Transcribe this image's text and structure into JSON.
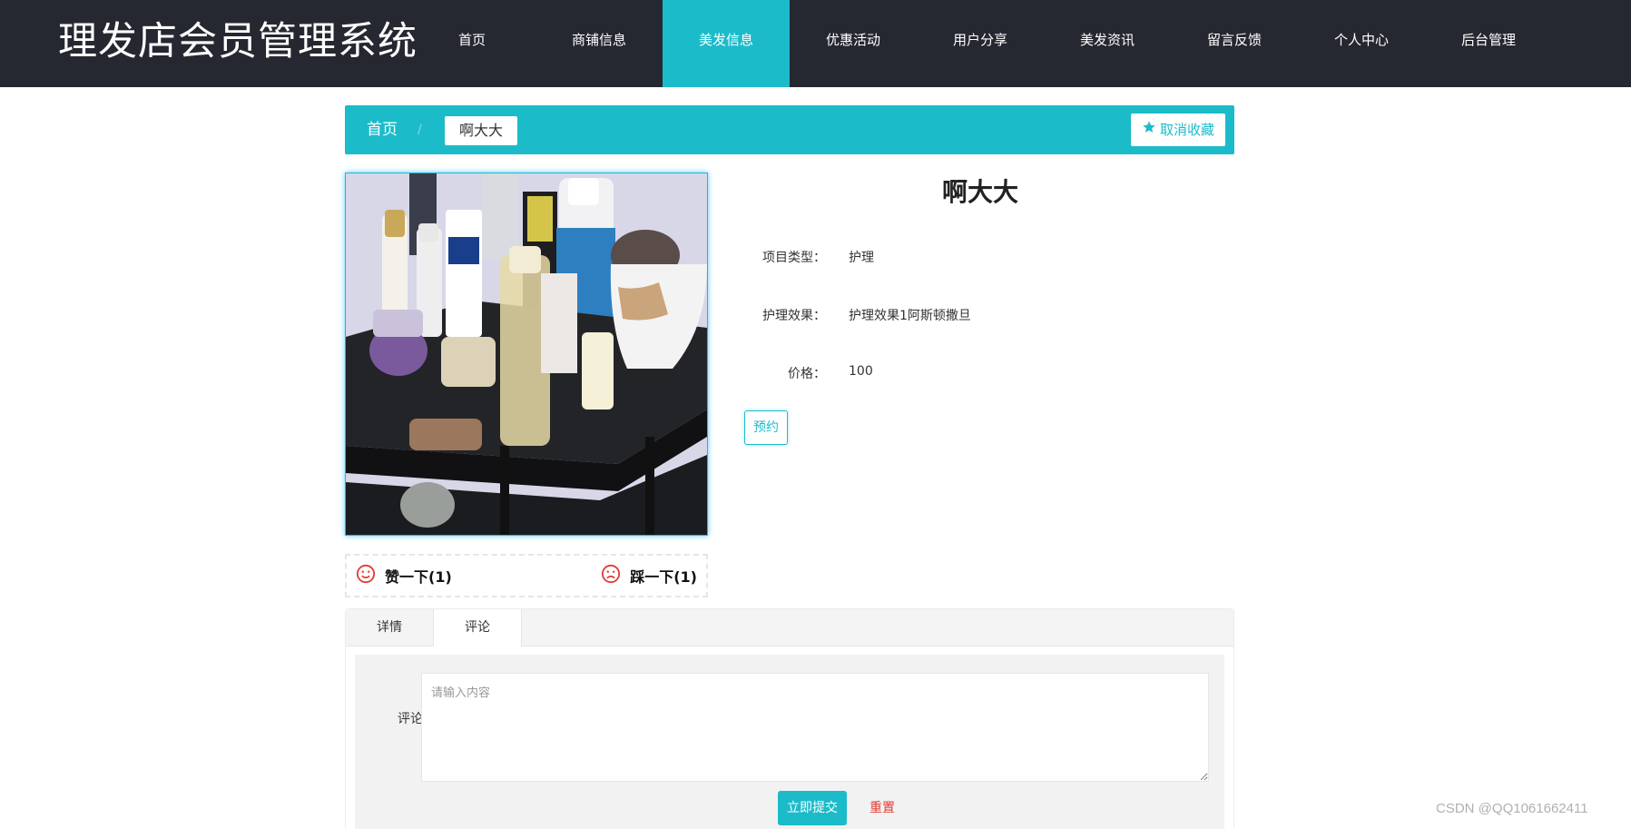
{
  "app": {
    "title": "理发店会员管理系统"
  },
  "nav": {
    "items": [
      {
        "label": "首页"
      },
      {
        "label": "商铺信息"
      },
      {
        "label": "美发信息",
        "active": true
      },
      {
        "label": "优惠活动"
      },
      {
        "label": "用户分享"
      },
      {
        "label": "美发资讯"
      },
      {
        "label": "留言反馈"
      },
      {
        "label": "个人中心"
      },
      {
        "label": "后台管理"
      }
    ]
  },
  "breadcrumb": {
    "home": "首页",
    "separator": "/",
    "current": "啊大大"
  },
  "favorite": {
    "label": "取消收藏",
    "icon": "star-icon"
  },
  "product": {
    "title": "啊大大",
    "fields": [
      {
        "label": "项目类型：",
        "value": "护理"
      },
      {
        "label": "护理效果：",
        "value": "护理效果1阿斯顿撒旦"
      },
      {
        "label": "价格：",
        "value": "100"
      }
    ],
    "book_label": "预约"
  },
  "votes": {
    "like_label": "赞一下(1)",
    "dislike_label": "踩一下(1)",
    "like_icon": "smile-icon",
    "dislike_icon": "frown-icon"
  },
  "tabs": [
    {
      "label": "详情"
    },
    {
      "label": "评论",
      "active": true
    }
  ],
  "comment": {
    "label": "评论",
    "placeholder": "请输入内容",
    "submit_label": "立即提交",
    "reset_label": "重置"
  },
  "watermark": "CSDN @QQ1061662411",
  "colors": {
    "primary": "#1cbbca",
    "header_bg": "#252830",
    "danger": "#e53935"
  }
}
